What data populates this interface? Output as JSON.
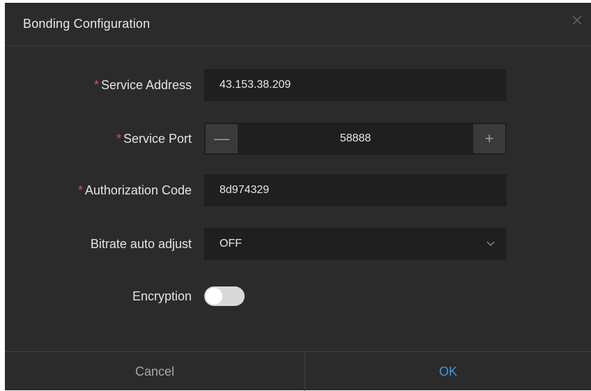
{
  "dialog": {
    "title": "Bonding Configuration"
  },
  "form": {
    "service_address": {
      "required_mark": "*",
      "label": "Service Address",
      "value": "43.153.38.209"
    },
    "service_port": {
      "required_mark": "*",
      "label": "Service Port",
      "value": "58888",
      "decrement_symbol": "—",
      "increment_symbol": "+"
    },
    "authorization_code": {
      "required_mark": "*",
      "label": "Authorization Code",
      "value": "8d974329"
    },
    "bitrate_auto_adjust": {
      "label": "Bitrate auto adjust",
      "selected": "OFF"
    },
    "encryption": {
      "label": "Encryption",
      "enabled": false
    }
  },
  "footer": {
    "cancel_label": "Cancel",
    "ok_label": "OK"
  },
  "colors": {
    "dialog_background": "#2b2b2b",
    "field_background": "#1f1f1f",
    "required_mark": "#e5484d",
    "ok_accent": "#3a9ae8"
  },
  "icons": {
    "close": "close-icon",
    "dropdown": "chevron-down-icon"
  }
}
